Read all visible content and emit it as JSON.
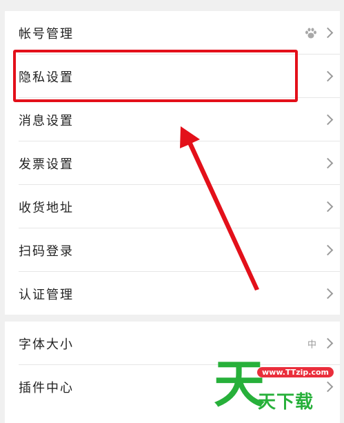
{
  "settings_group_1": {
    "items": [
      {
        "label": "帐号管理",
        "extra_icon": "paw-icon"
      },
      {
        "label": "隐私设置"
      },
      {
        "label": "消息设置"
      },
      {
        "label": "发票设置"
      },
      {
        "label": "收货地址"
      },
      {
        "label": "扫码登录"
      },
      {
        "label": "认证管理"
      }
    ]
  },
  "settings_group_2": {
    "items": [
      {
        "label": "字体大小",
        "value": "中"
      },
      {
        "label": "插件中心"
      }
    ]
  },
  "annotation": {
    "highlight_color": "#e3101a",
    "highlighted_item": "隐私设置"
  },
  "watermark": {
    "sky_char": "天",
    "url": "www.TTzip.com",
    "name": "天下载",
    "color": "#27b03a",
    "bubble_color": "#ea2e3b"
  }
}
